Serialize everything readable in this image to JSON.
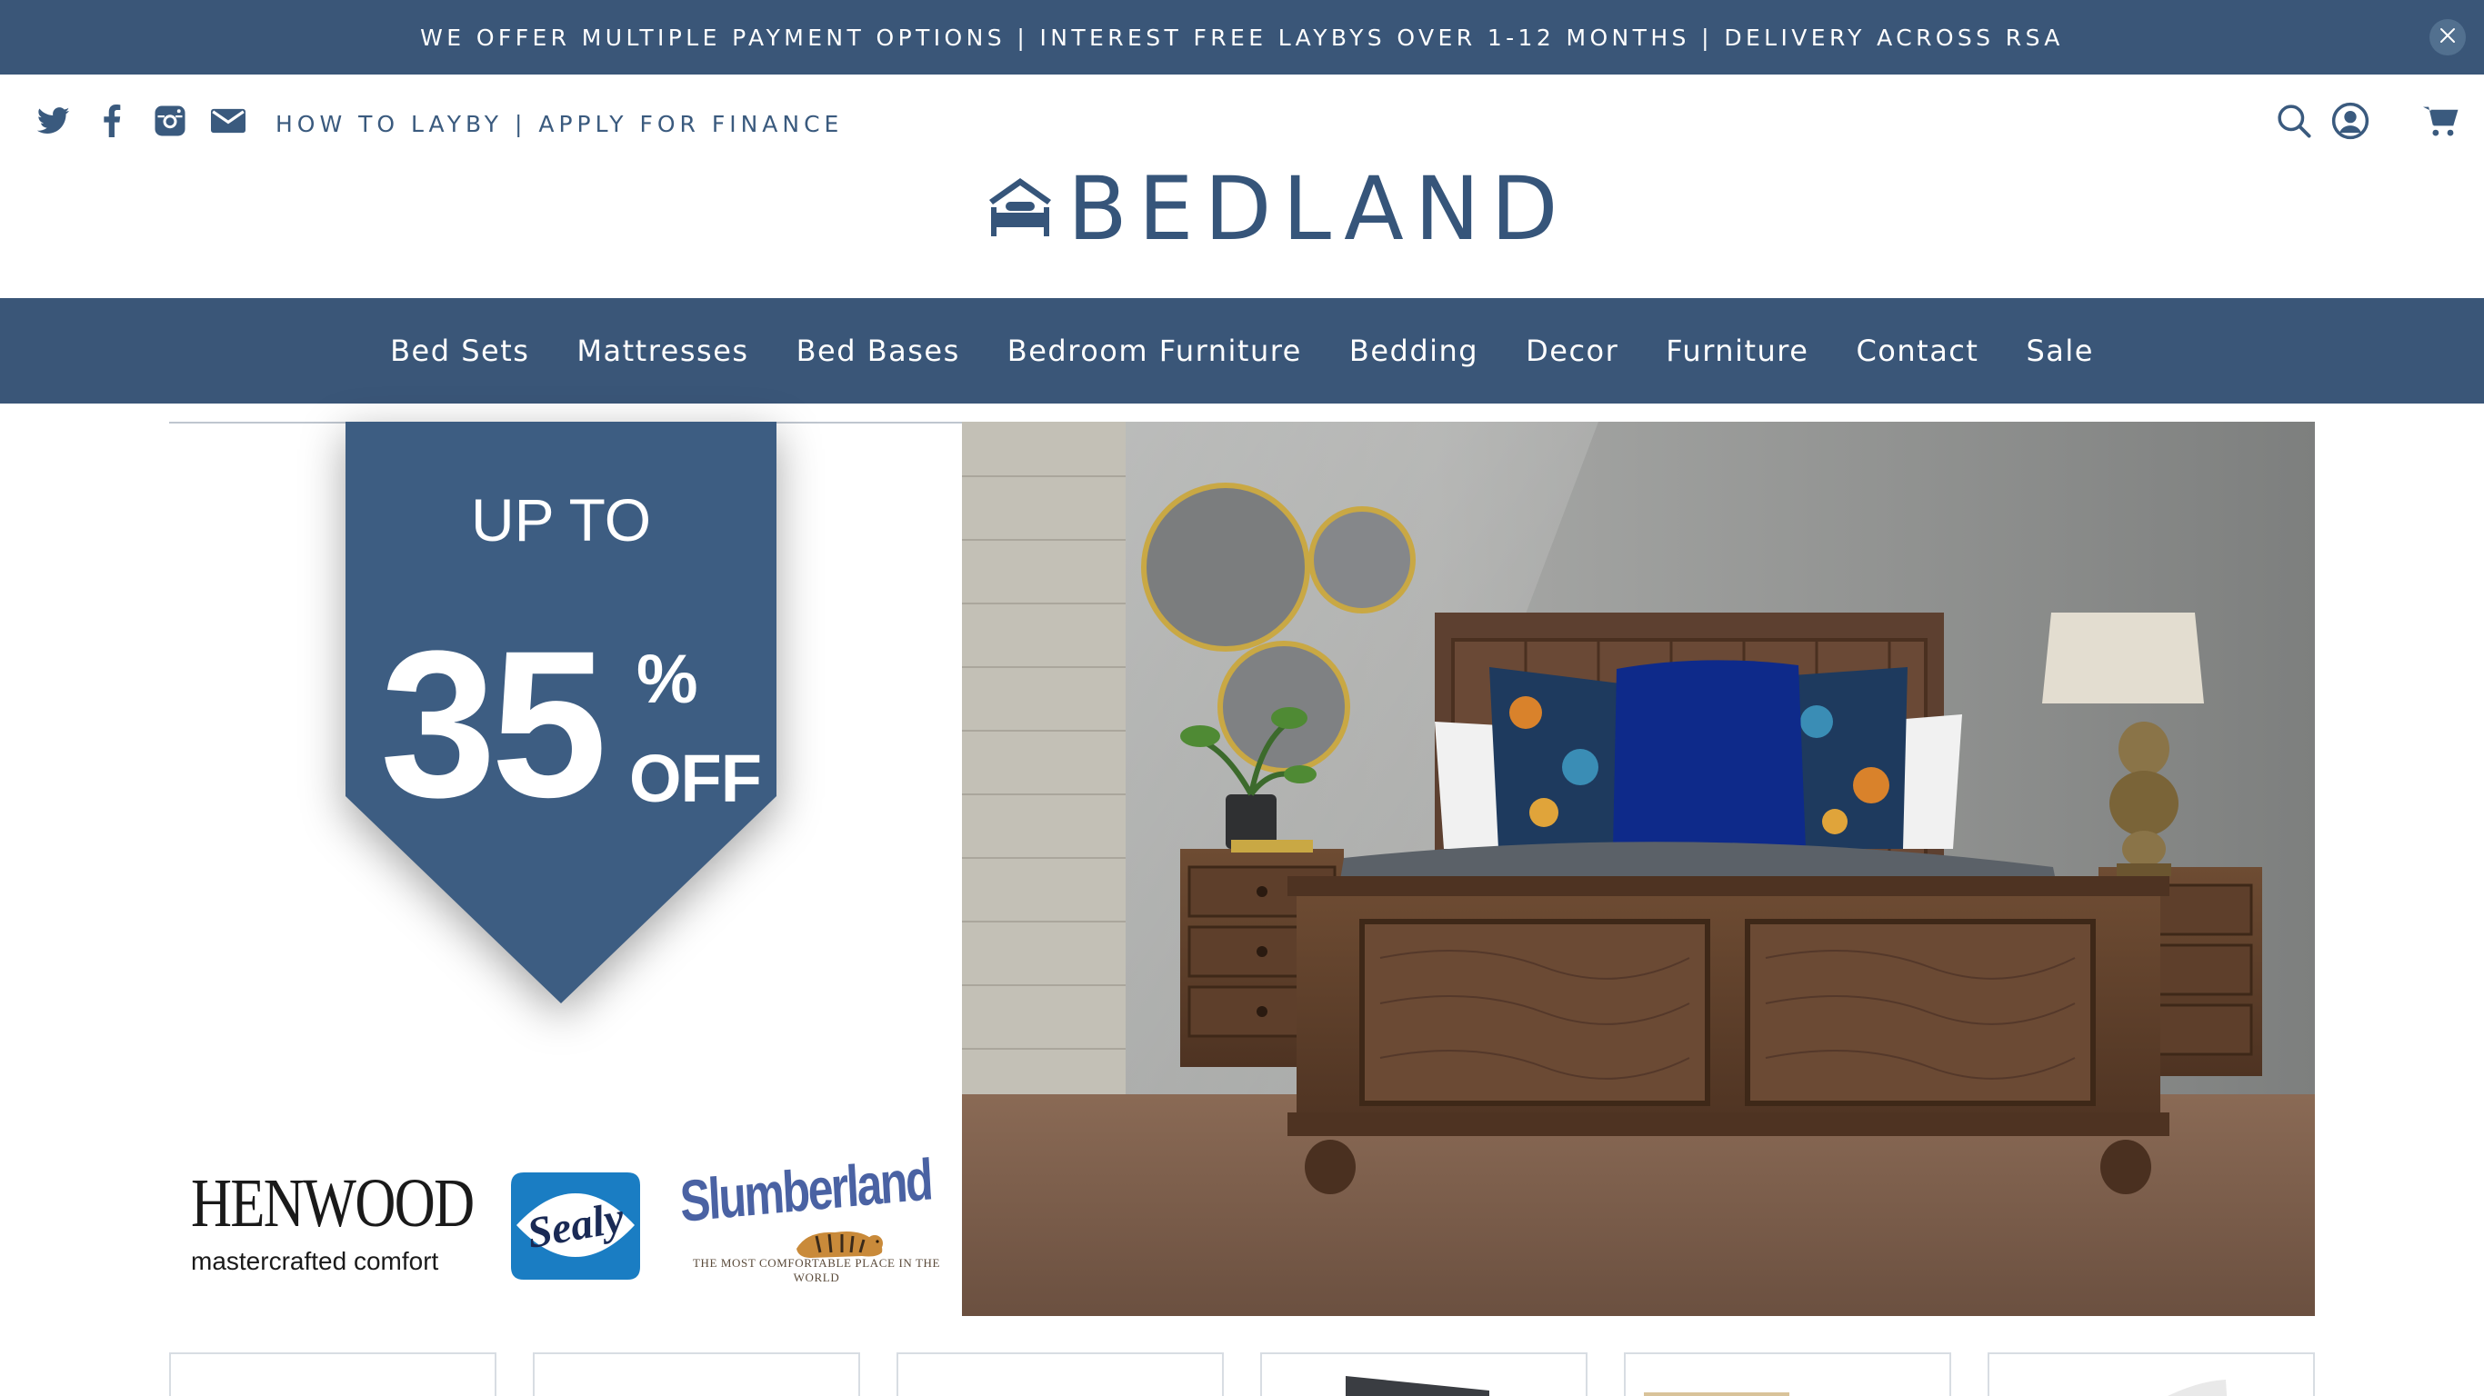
{
  "announcement": {
    "text": "WE OFFER MULTIPLE PAYMENT OPTIONS | INTEREST FREE LAYBYS OVER 1-12 MONTHS | DELIVERY ACROSS RSA"
  },
  "header": {
    "social_icons": [
      "twitter-icon",
      "facebook-icon",
      "instagram-icon",
      "mail-icon"
    ],
    "links": {
      "layby": "HOW TO LAYBY",
      "separator": "|",
      "finance": "APPLY FOR FINANCE"
    },
    "right_icons": [
      "search-icon",
      "account-icon",
      "cart-icon"
    ],
    "logo_text": "BEDLAND"
  },
  "nav": {
    "items": [
      {
        "label": "Bed Sets"
      },
      {
        "label": "Mattresses"
      },
      {
        "label": "Bed Bases"
      },
      {
        "label": "Bedroom Furniture"
      },
      {
        "label": "Bedding"
      },
      {
        "label": "Decor"
      },
      {
        "label": "Furniture"
      },
      {
        "label": "Contact"
      },
      {
        "label": "Sale"
      }
    ]
  },
  "banner": {
    "ribbon": {
      "line1": "UP TO",
      "number": "35",
      "percent": "%",
      "off": "OFF"
    },
    "brands": {
      "henwood": {
        "name": "HENWOOD",
        "tagline": "mastercrafted comfort"
      },
      "sealy": {
        "name": "Sealy"
      },
      "slumberland": {
        "name": "Slumberland",
        "tagline": "THE MOST COMFORTABLE PLACE IN THE WORLD"
      }
    }
  },
  "colors": {
    "brand_navy": "#3a5678",
    "logo_blue": "#36557a",
    "text_white": "#ffffff"
  }
}
